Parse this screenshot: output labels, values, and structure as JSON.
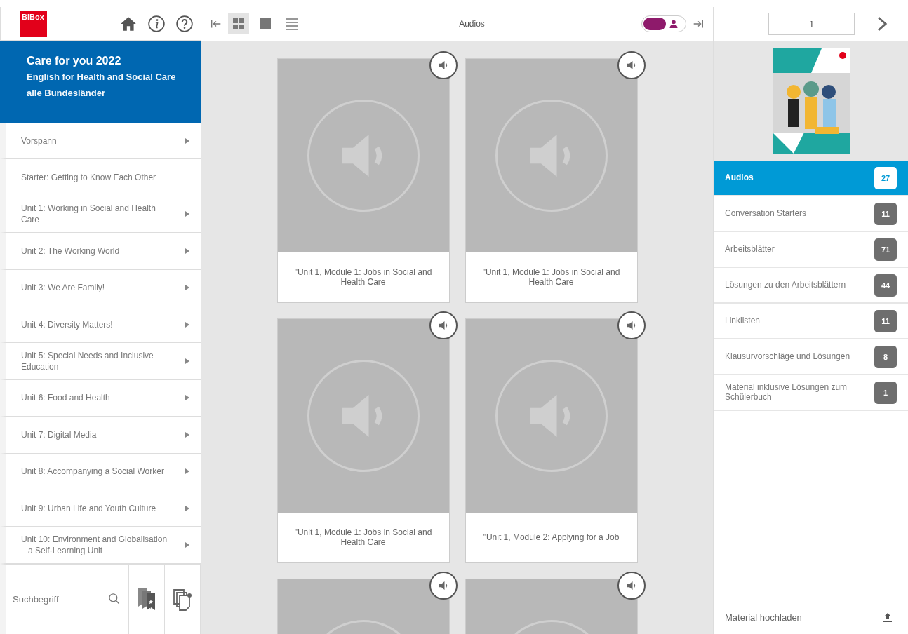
{
  "app": {
    "logo": "BiBox"
  },
  "book": {
    "title": "Care for you 2022",
    "subtitle": "English for Health and Social Care",
    "edition": "alle Bundesländer"
  },
  "chapters": [
    {
      "label": "Vorspann",
      "has_children": true
    },
    {
      "label": "Starter: Getting to Know Each Other",
      "has_children": false
    },
    {
      "label": "Unit 1: Working in Social and Health Care",
      "has_children": true
    },
    {
      "label": "Unit 2: The Working World",
      "has_children": true
    },
    {
      "label": "Unit 3: We Are Family!",
      "has_children": true
    },
    {
      "label": "Unit 4: Diversity Matters!",
      "has_children": true
    },
    {
      "label": "Unit 5: Special Needs and Inclusive Education",
      "has_children": true
    },
    {
      "label": "Unit 6: Food and Health",
      "has_children": true
    },
    {
      "label": "Unit 7: Digital Media",
      "has_children": true
    },
    {
      "label": "Unit 8: Accompanying a Social Worker",
      "has_children": true
    },
    {
      "label": "Unit 9: Urban Life and Youth Culture",
      "has_children": true
    },
    {
      "label": "Unit 10: Environment and Globalisation – a Self-Learning Unit",
      "has_children": true
    }
  ],
  "search": {
    "placeholder": "Suchbegriff"
  },
  "toolbar": {
    "title": "Audios",
    "views": [
      {
        "kind": "grid",
        "selected": true
      },
      {
        "kind": "single",
        "selected": false
      },
      {
        "kind": "list",
        "selected": false
      }
    ],
    "toggle": {
      "on": true
    }
  },
  "materials": [
    {
      "kind": "audio",
      "title": "\"Unit 1, Module 1: Jobs in Social and Health Care"
    },
    {
      "kind": "audio",
      "title": "\"Unit 1, Module 1: Jobs in Social and Health Care"
    },
    {
      "kind": "audio",
      "title": "\"Unit 1, Module 1: Jobs in Social and Health Care"
    },
    {
      "kind": "audio",
      "title": "\"Unit 1, Module 2: Applying for a Job"
    },
    {
      "kind": "audio"
    },
    {
      "kind": "audio"
    }
  ],
  "pager": {
    "page": "1"
  },
  "categories": [
    {
      "label": "Audios",
      "count": "27",
      "selected": true
    },
    {
      "label": "Conversation Starters",
      "count": "11",
      "selected": false
    },
    {
      "label": "Arbeitsblätter",
      "count": "71",
      "selected": false
    },
    {
      "label": "Lösungen zu den Arbeitsblättern",
      "count": "44",
      "selected": false
    },
    {
      "label": "Linklisten",
      "count": "11",
      "selected": false
    },
    {
      "label": "Klausurvorschläge und Lösungen",
      "count": "8",
      "selected": false
    },
    {
      "label": "Material inklusive Lösungen zum Schülerbuch",
      "count": "1",
      "selected": false
    }
  ],
  "upload": {
    "label": "Material hochladen"
  }
}
